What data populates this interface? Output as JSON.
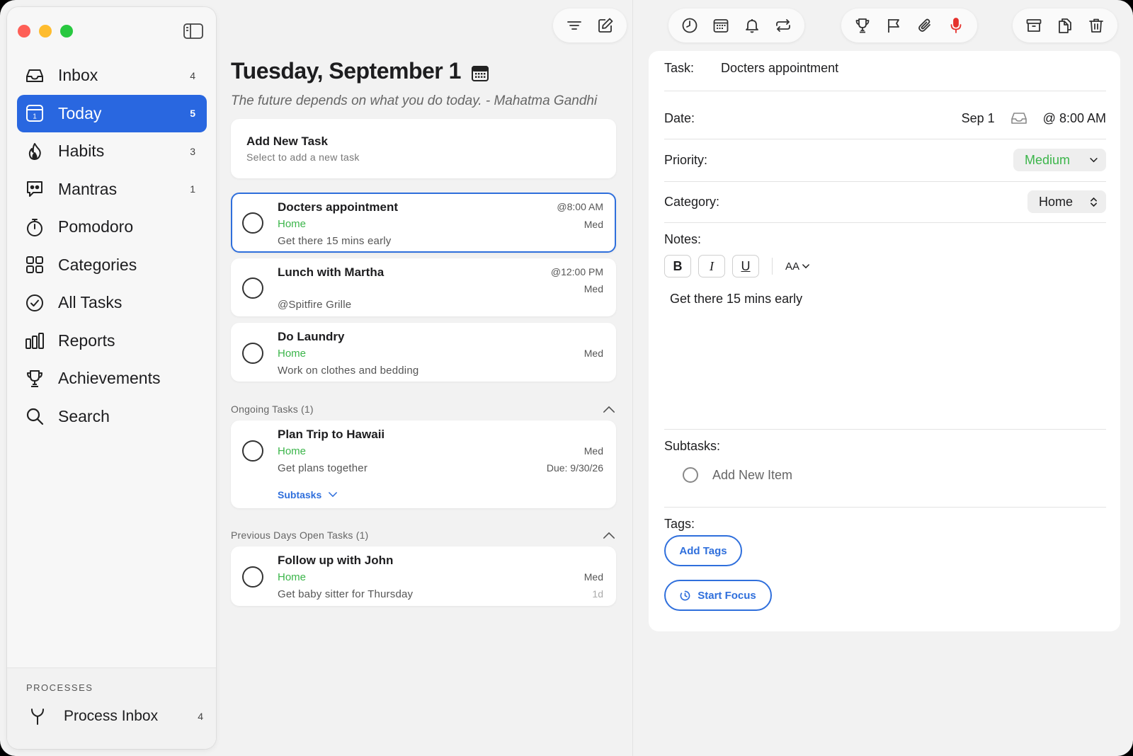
{
  "sidebar": {
    "items": [
      {
        "label": "Inbox",
        "count": "4"
      },
      {
        "label": "Today",
        "count": "5"
      },
      {
        "label": "Habits",
        "count": "3"
      },
      {
        "label": "Mantras",
        "count": "1"
      },
      {
        "label": "Pomodoro",
        "count": ""
      },
      {
        "label": "Categories",
        "count": ""
      },
      {
        "label": "All Tasks",
        "count": ""
      },
      {
        "label": "Reports",
        "count": ""
      },
      {
        "label": "Achievements",
        "count": ""
      },
      {
        "label": "Search",
        "count": ""
      }
    ],
    "processes_title": "PROCESSES",
    "process_inbox": {
      "label": "Process Inbox",
      "count": "4"
    }
  },
  "main": {
    "date_title": "Tuesday, September 1",
    "quote": "The future depends on what you do today. - Mahatma Gandhi",
    "add_task": {
      "title": "Add New Task",
      "subtitle": "Select to add a new task"
    },
    "tasks": [
      {
        "title": "Docters appointment",
        "category": "Home",
        "note": "Get there 15 mins early",
        "time": "@8:00 AM",
        "priority": "Med"
      },
      {
        "title": "Lunch with Martha",
        "category": "",
        "note": "@Spitfire Grille",
        "time": "@12:00 PM",
        "priority": "Med"
      },
      {
        "title": "Do Laundry",
        "category": "Home",
        "note": "Work on clothes and bedding",
        "time": "",
        "priority": "Med"
      }
    ],
    "ongoing_header": "Ongoing Tasks (1)",
    "ongoing": {
      "title": "Plan Trip to Hawaii",
      "category": "Home",
      "note": "Get plans together",
      "priority": "Med",
      "due": "Due: 9/30/26",
      "subtasks_label": "Subtasks"
    },
    "previous_header": "Previous Days Open Tasks (1)",
    "previous": {
      "title": "Follow up with John",
      "category": "Home",
      "note": "Get baby sitter for Thursday",
      "priority": "Med",
      "age": "1d"
    }
  },
  "detail": {
    "task_label": "Task:",
    "task_value": "Docters appointment",
    "date_label": "Date:",
    "date_value": "Sep 1",
    "time_value": "@ 8:00 AM",
    "priority_label": "Priority:",
    "priority_value": "Medium",
    "category_label": "Category:",
    "category_value": "Home",
    "notes_label": "Notes:",
    "fmt": {
      "bold": "B",
      "italic": "I",
      "underline": "U",
      "size": "AA"
    },
    "notes_text": "Get there 15 mins early",
    "subtasks_label": "Subtasks:",
    "add_item": "Add New Item",
    "tags_label": "Tags:",
    "add_tags": "Add Tags",
    "start_focus": "Start Focus"
  },
  "colors": {
    "accent": "#2967e0",
    "category_green": "#3bb54a",
    "mic_red": "#e5322d"
  }
}
